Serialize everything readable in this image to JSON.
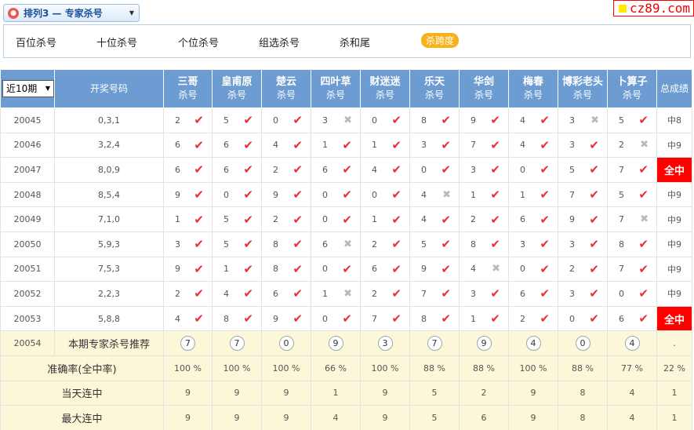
{
  "header": {
    "title": "排列3 — 专家杀号",
    "logo_text": "cz89.com"
  },
  "menu": {
    "items": [
      "百位杀号",
      "十位杀号",
      "个位杀号",
      "组选杀号",
      "杀和尾"
    ],
    "active": "杀跨度"
  },
  "table": {
    "period_select": "近10期",
    "col_draw": "开奖号码",
    "col_total": "总成绩",
    "sub_label": "杀号",
    "experts": [
      "三哥",
      "皇甫原",
      "楚云",
      "四叶草",
      "财迷迷",
      "乐天",
      "华剑",
      "梅春",
      "博彩老头",
      "卜算子"
    ],
    "rows": [
      {
        "period": "20045",
        "draw": "0,3,1",
        "kills": [
          [
            "2",
            "ok"
          ],
          [
            "5",
            "ok"
          ],
          [
            "0",
            "ok"
          ],
          [
            "3",
            "no"
          ],
          [
            "0",
            "ok"
          ],
          [
            "8",
            "ok"
          ],
          [
            "9",
            "ok"
          ],
          [
            "4",
            "ok"
          ],
          [
            "3",
            "no"
          ],
          [
            "5",
            "ok"
          ]
        ],
        "total": "中8"
      },
      {
        "period": "20046",
        "draw": "3,2,4",
        "kills": [
          [
            "6",
            "ok"
          ],
          [
            "6",
            "ok"
          ],
          [
            "4",
            "ok"
          ],
          [
            "1",
            "ok"
          ],
          [
            "1",
            "ok"
          ],
          [
            "3",
            "ok"
          ],
          [
            "7",
            "ok"
          ],
          [
            "4",
            "ok"
          ],
          [
            "3",
            "ok"
          ],
          [
            "2",
            "no"
          ]
        ],
        "total": "中9"
      },
      {
        "period": "20047",
        "draw": "8,0,9",
        "kills": [
          [
            "6",
            "ok"
          ],
          [
            "6",
            "ok"
          ],
          [
            "2",
            "ok"
          ],
          [
            "6",
            "ok"
          ],
          [
            "4",
            "ok"
          ],
          [
            "0",
            "ok"
          ],
          [
            "3",
            "ok"
          ],
          [
            "0",
            "ok"
          ],
          [
            "5",
            "ok"
          ],
          [
            "7",
            "ok"
          ]
        ],
        "total": "全中"
      },
      {
        "period": "20048",
        "draw": "8,5,4",
        "kills": [
          [
            "9",
            "ok"
          ],
          [
            "0",
            "ok"
          ],
          [
            "9",
            "ok"
          ],
          [
            "0",
            "ok"
          ],
          [
            "0",
            "ok"
          ],
          [
            "4",
            "no"
          ],
          [
            "1",
            "ok"
          ],
          [
            "1",
            "ok"
          ],
          [
            "7",
            "ok"
          ],
          [
            "5",
            "ok"
          ]
        ],
        "total": "中9"
      },
      {
        "period": "20049",
        "draw": "7,1,0",
        "kills": [
          [
            "1",
            "ok"
          ],
          [
            "5",
            "ok"
          ],
          [
            "2",
            "ok"
          ],
          [
            "0",
            "ok"
          ],
          [
            "1",
            "ok"
          ],
          [
            "4",
            "ok"
          ],
          [
            "2",
            "ok"
          ],
          [
            "6",
            "ok"
          ],
          [
            "9",
            "ok"
          ],
          [
            "7",
            "no"
          ]
        ],
        "total": "中9"
      },
      {
        "period": "20050",
        "draw": "5,9,3",
        "kills": [
          [
            "3",
            "ok"
          ],
          [
            "5",
            "ok"
          ],
          [
            "8",
            "ok"
          ],
          [
            "6",
            "no"
          ],
          [
            "2",
            "ok"
          ],
          [
            "5",
            "ok"
          ],
          [
            "8",
            "ok"
          ],
          [
            "3",
            "ok"
          ],
          [
            "3",
            "ok"
          ],
          [
            "8",
            "ok"
          ]
        ],
        "total": "中9"
      },
      {
        "period": "20051",
        "draw": "7,5,3",
        "kills": [
          [
            "9",
            "ok"
          ],
          [
            "1",
            "ok"
          ],
          [
            "8",
            "ok"
          ],
          [
            "0",
            "ok"
          ],
          [
            "6",
            "ok"
          ],
          [
            "9",
            "ok"
          ],
          [
            "4",
            "no"
          ],
          [
            "0",
            "ok"
          ],
          [
            "2",
            "ok"
          ],
          [
            "7",
            "ok"
          ]
        ],
        "total": "中9"
      },
      {
        "period": "20052",
        "draw": "2,2,3",
        "kills": [
          [
            "2",
            "ok"
          ],
          [
            "4",
            "ok"
          ],
          [
            "6",
            "ok"
          ],
          [
            "1",
            "no"
          ],
          [
            "2",
            "ok"
          ],
          [
            "7",
            "ok"
          ],
          [
            "3",
            "ok"
          ],
          [
            "6",
            "ok"
          ],
          [
            "3",
            "ok"
          ],
          [
            "0",
            "ok"
          ]
        ],
        "total": "中9"
      },
      {
        "period": "20053",
        "draw": "5,8,8",
        "kills": [
          [
            "4",
            "ok"
          ],
          [
            "8",
            "ok"
          ],
          [
            "9",
            "ok"
          ],
          [
            "0",
            "ok"
          ],
          [
            "7",
            "ok"
          ],
          [
            "8",
            "ok"
          ],
          [
            "1",
            "ok"
          ],
          [
            "2",
            "ok"
          ],
          [
            "0",
            "ok"
          ],
          [
            "6",
            "ok"
          ]
        ],
        "total": "全中"
      }
    ],
    "recommend": {
      "period": "20054",
      "label": "本期专家杀号推荐",
      "values": [
        "7",
        "7",
        "0",
        "9",
        "3",
        "7",
        "9",
        "4",
        "0",
        "4"
      ],
      "total": "."
    },
    "stats": [
      {
        "label": "准确率(全中率)",
        "values": [
          "100 %",
          "100 %",
          "100 %",
          "66 %",
          "100 %",
          "88 %",
          "88 %",
          "100 %",
          "88 %",
          "77 %"
        ],
        "total": "22 %"
      },
      {
        "label": "当天连中",
        "values": [
          "9",
          "9",
          "9",
          "1",
          "9",
          "5",
          "2",
          "9",
          "8",
          "4"
        ],
        "total": "1"
      },
      {
        "label": "最大连中",
        "values": [
          "9",
          "9",
          "9",
          "4",
          "9",
          "5",
          "6",
          "9",
          "8",
          "4"
        ],
        "total": "1"
      }
    ]
  },
  "colors": {
    "header_bg": "#6d9cd3",
    "hit": "#e8303a",
    "full_hit_bg": "#ff0000",
    "active_menu": "#f7b11b",
    "stat_bg": "#fdf7d9"
  },
  "icons": {
    "hit": "check-icon",
    "miss": "cross-icon"
  }
}
